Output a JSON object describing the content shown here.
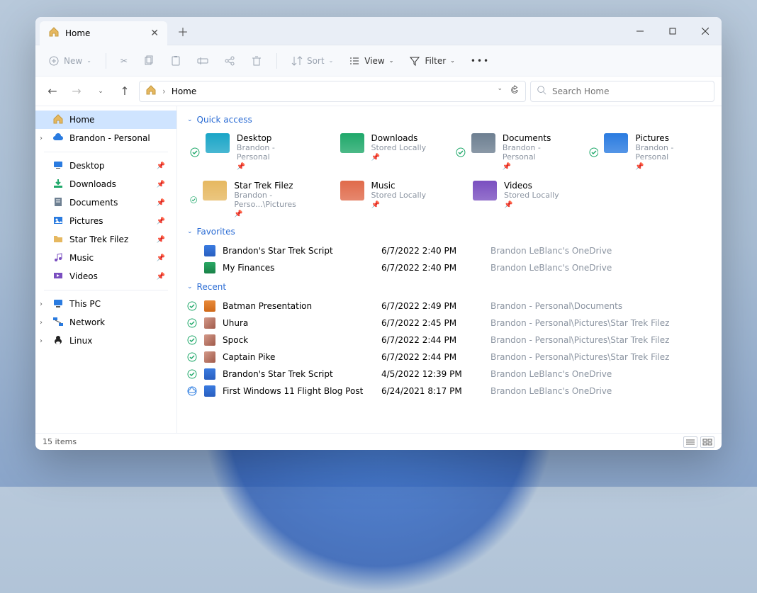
{
  "tab": {
    "title": "Home"
  },
  "toolbar": {
    "new": "New",
    "sort": "Sort",
    "view": "View",
    "filter": "Filter"
  },
  "address": {
    "crumb": "Home",
    "sep": "›"
  },
  "search": {
    "placeholder": "Search Home"
  },
  "sidebar": {
    "home": "Home",
    "onedrive": "Brandon - Personal",
    "quick": [
      {
        "label": "Desktop",
        "icon": "desktop"
      },
      {
        "label": "Downloads",
        "icon": "downloads"
      },
      {
        "label": "Documents",
        "icon": "documents"
      },
      {
        "label": "Pictures",
        "icon": "pictures"
      },
      {
        "label": "Star Trek Filez",
        "icon": "folder-yellow"
      },
      {
        "label": "Music",
        "icon": "music"
      },
      {
        "label": "Videos",
        "icon": "videos"
      }
    ],
    "thispc": "This PC",
    "network": "Network",
    "linux": "Linux"
  },
  "sections": {
    "quick": "Quick access",
    "favorites": "Favorites",
    "recent": "Recent"
  },
  "quick_access": [
    {
      "title": "Desktop",
      "subtitle": "Brandon - Personal",
      "color": "#1aa5c7",
      "sync": true
    },
    {
      "title": "Downloads",
      "subtitle": "Stored Locally",
      "color": "#1fa86a"
    },
    {
      "title": "Documents",
      "subtitle": "Brandon - Personal",
      "color": "#6d7f91",
      "sync": true
    },
    {
      "title": "Pictures",
      "subtitle": "Brandon - Personal",
      "color": "#2a7be0",
      "sync": true
    },
    {
      "title": "Star Trek Filez",
      "subtitle": "Brandon - Perso...\\Pictures",
      "color": "#e6b860",
      "sync": true
    },
    {
      "title": "Music",
      "subtitle": "Stored Locally",
      "color": "#e06a4a"
    },
    {
      "title": "Videos",
      "subtitle": "Stored Locally",
      "color": "#7a4fc0"
    }
  ],
  "favorites": [
    {
      "name": "Brandon's Star Trek Script",
      "date": "6/7/2022 2:40 PM",
      "location": "Brandon LeBlanc's OneDrive",
      "ftype": "doc-blue"
    },
    {
      "name": "My Finances",
      "date": "6/7/2022 2:40 PM",
      "location": "Brandon LeBlanc's OneDrive",
      "ftype": "doc-green"
    }
  ],
  "recent": [
    {
      "name": "Batman Presentation",
      "date": "6/7/2022 2:49 PM",
      "location": "Brandon - Personal\\Documents",
      "ftype": "doc-orange",
      "sync": true
    },
    {
      "name": "Uhura",
      "date": "6/7/2022 2:45 PM",
      "location": "Brandon - Personal\\Pictures\\Star Trek Filez",
      "ftype": "img-thumb",
      "sync": true
    },
    {
      "name": "Spock",
      "date": "6/7/2022 2:44 PM",
      "location": "Brandon - Personal\\Pictures\\Star Trek Filez",
      "ftype": "img-thumb",
      "sync": true
    },
    {
      "name": "Captain Pike",
      "date": "6/7/2022 2:44 PM",
      "location": "Brandon - Personal\\Pictures\\Star Trek Filez",
      "ftype": "img-thumb",
      "sync": true
    },
    {
      "name": "Brandon's Star Trek Script",
      "date": "4/5/2022 12:39 PM",
      "location": "Brandon LeBlanc's OneDrive",
      "ftype": "doc-blue",
      "sync": true
    },
    {
      "name": "First Windows 11 Flight Blog Post",
      "date": "6/24/2021 8:17 PM",
      "location": "Brandon LeBlanc's OneDrive",
      "ftype": "doc-blue",
      "cloud": true
    }
  ],
  "status": {
    "count": "15 items"
  }
}
